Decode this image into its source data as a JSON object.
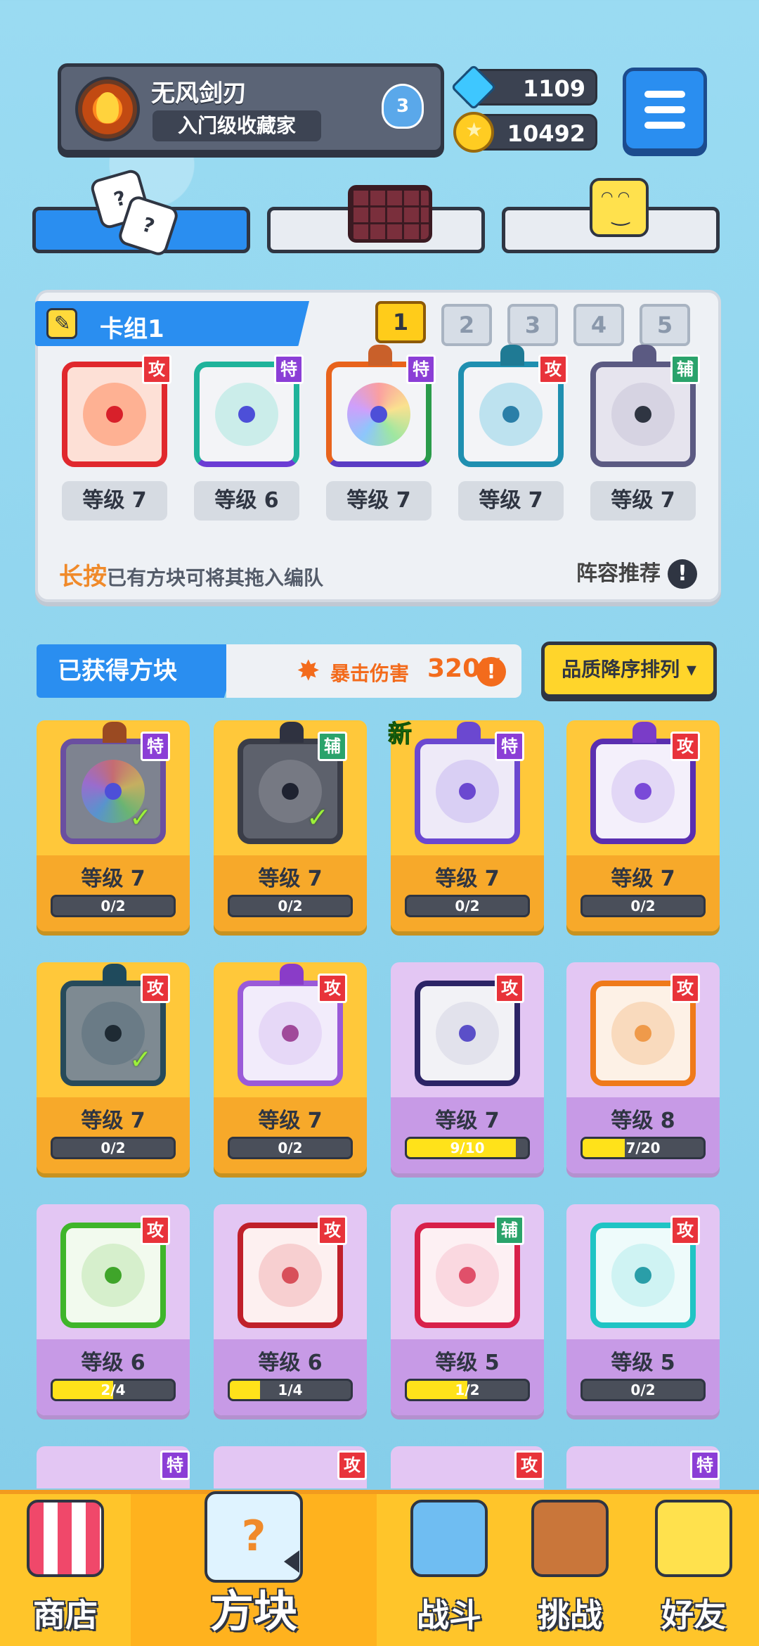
{
  "profile": {
    "name": "无风剑刃",
    "title": "入门级收藏家",
    "medal": "3"
  },
  "currency": {
    "gems": "1109",
    "coins": "10492"
  },
  "deck": {
    "title": "卡组1",
    "tabs": [
      "1",
      "2",
      "3",
      "4",
      "5"
    ],
    "active_tab": "1",
    "cards": [
      {
        "badge": "攻",
        "level": "等级 7"
      },
      {
        "badge": "特",
        "level": "等级 6"
      },
      {
        "badge": "特",
        "level": "等级 7"
      },
      {
        "badge": "攻",
        "level": "等级 7"
      },
      {
        "badge": "辅",
        "level": "等级 7"
      }
    ],
    "hint_highlight": "长按",
    "hint": "已有方块可将其拖入编队",
    "recommend": "阵容推荐",
    "recommend_icon": "!"
  },
  "obtained": {
    "label": "已获得方块",
    "crit_label": "暴击伤害",
    "crit_value": "320%",
    "info_icon": "!",
    "sort_label": "品质降序排列 ▾"
  },
  "new_tag": "新",
  "collection": [
    {
      "badge": "特",
      "level": "等级 7",
      "progress": "0/2",
      "fill": 0
    },
    {
      "badge": "辅",
      "level": "等级 7",
      "progress": "0/2",
      "fill": 0
    },
    {
      "badge": "特",
      "level": "等级 7",
      "progress": "0/2",
      "fill": 0
    },
    {
      "badge": "攻",
      "level": "等级 7",
      "progress": "0/2",
      "fill": 0
    },
    {
      "badge": "攻",
      "level": "等级 7",
      "progress": "0/2",
      "fill": 0
    },
    {
      "badge": "攻",
      "level": "等级 7",
      "progress": "0/2",
      "fill": 0
    },
    {
      "badge": "攻",
      "level": "等级 7",
      "progress": "9/10",
      "fill": 0.9
    },
    {
      "badge": "攻",
      "level": "等级 8",
      "progress": "7/20",
      "fill": 0.35
    },
    {
      "badge": "攻",
      "level": "等级 6",
      "progress": "2/4",
      "fill": 0.5
    },
    {
      "badge": "攻",
      "level": "等级 6",
      "progress": "1/4",
      "fill": 0.25
    },
    {
      "badge": "辅",
      "level": "等级 5",
      "progress": "1/2",
      "fill": 0.5
    },
    {
      "badge": "攻",
      "level": "等级 5",
      "progress": "0/2",
      "fill": 0
    }
  ],
  "partial_badges": [
    "特",
    "攻",
    "攻",
    "特"
  ],
  "nav": {
    "shop": "商店",
    "blocks": "方块",
    "battle": "战斗",
    "challenge": "挑战",
    "friends": "好友"
  }
}
